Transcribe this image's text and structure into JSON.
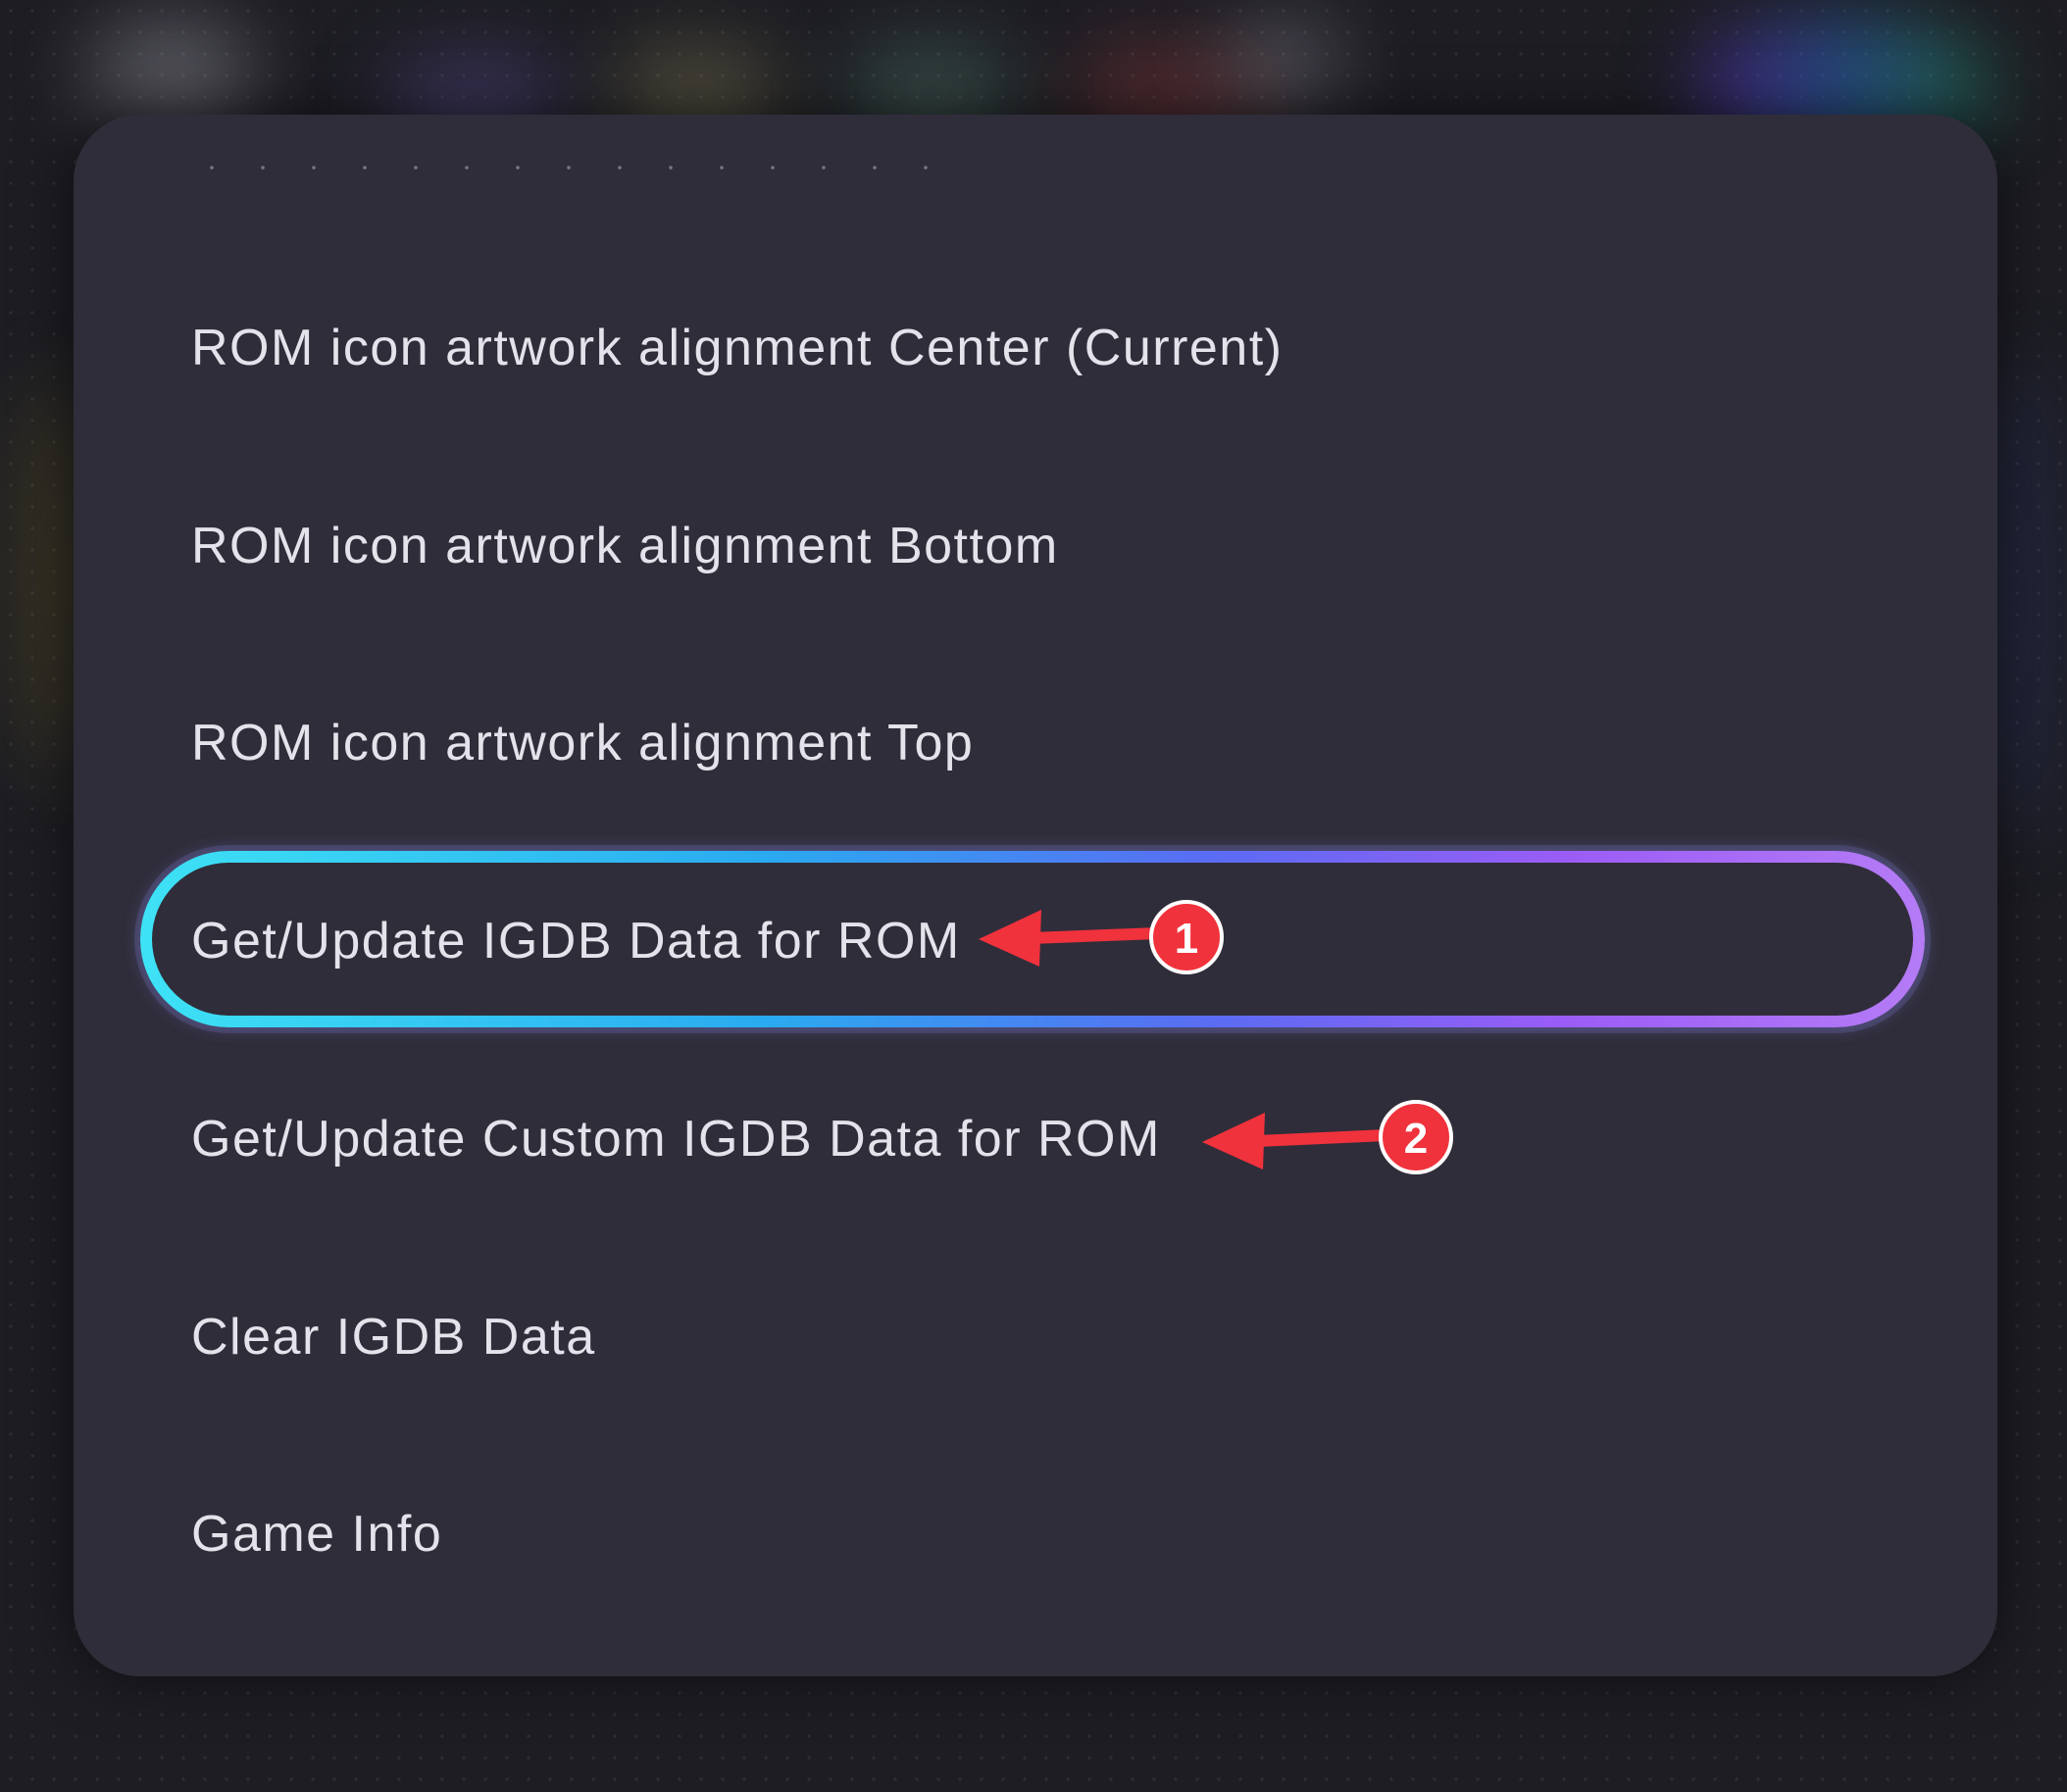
{
  "menu": {
    "items": [
      {
        "label": "ROM icon artwork alignment Center (Current)"
      },
      {
        "label": "ROM icon artwork alignment Bottom"
      },
      {
        "label": "ROM icon artwork alignment Top"
      },
      {
        "label": "Get/Update IGDB Data for ROM"
      },
      {
        "label": "Get/Update Custom IGDB Data for ROM"
      },
      {
        "label": "Clear IGDB Data"
      },
      {
        "label": "Game Info"
      }
    ],
    "focused_index": 3
  },
  "annotations": [
    {
      "number": "1"
    },
    {
      "number": "2"
    }
  ],
  "colors": {
    "dialog_bg": "#302d3a",
    "text": "#e4e2ea",
    "focus_start": "#3ee2f5",
    "focus_end": "#b57cf6",
    "annotation": "#f0323c"
  }
}
